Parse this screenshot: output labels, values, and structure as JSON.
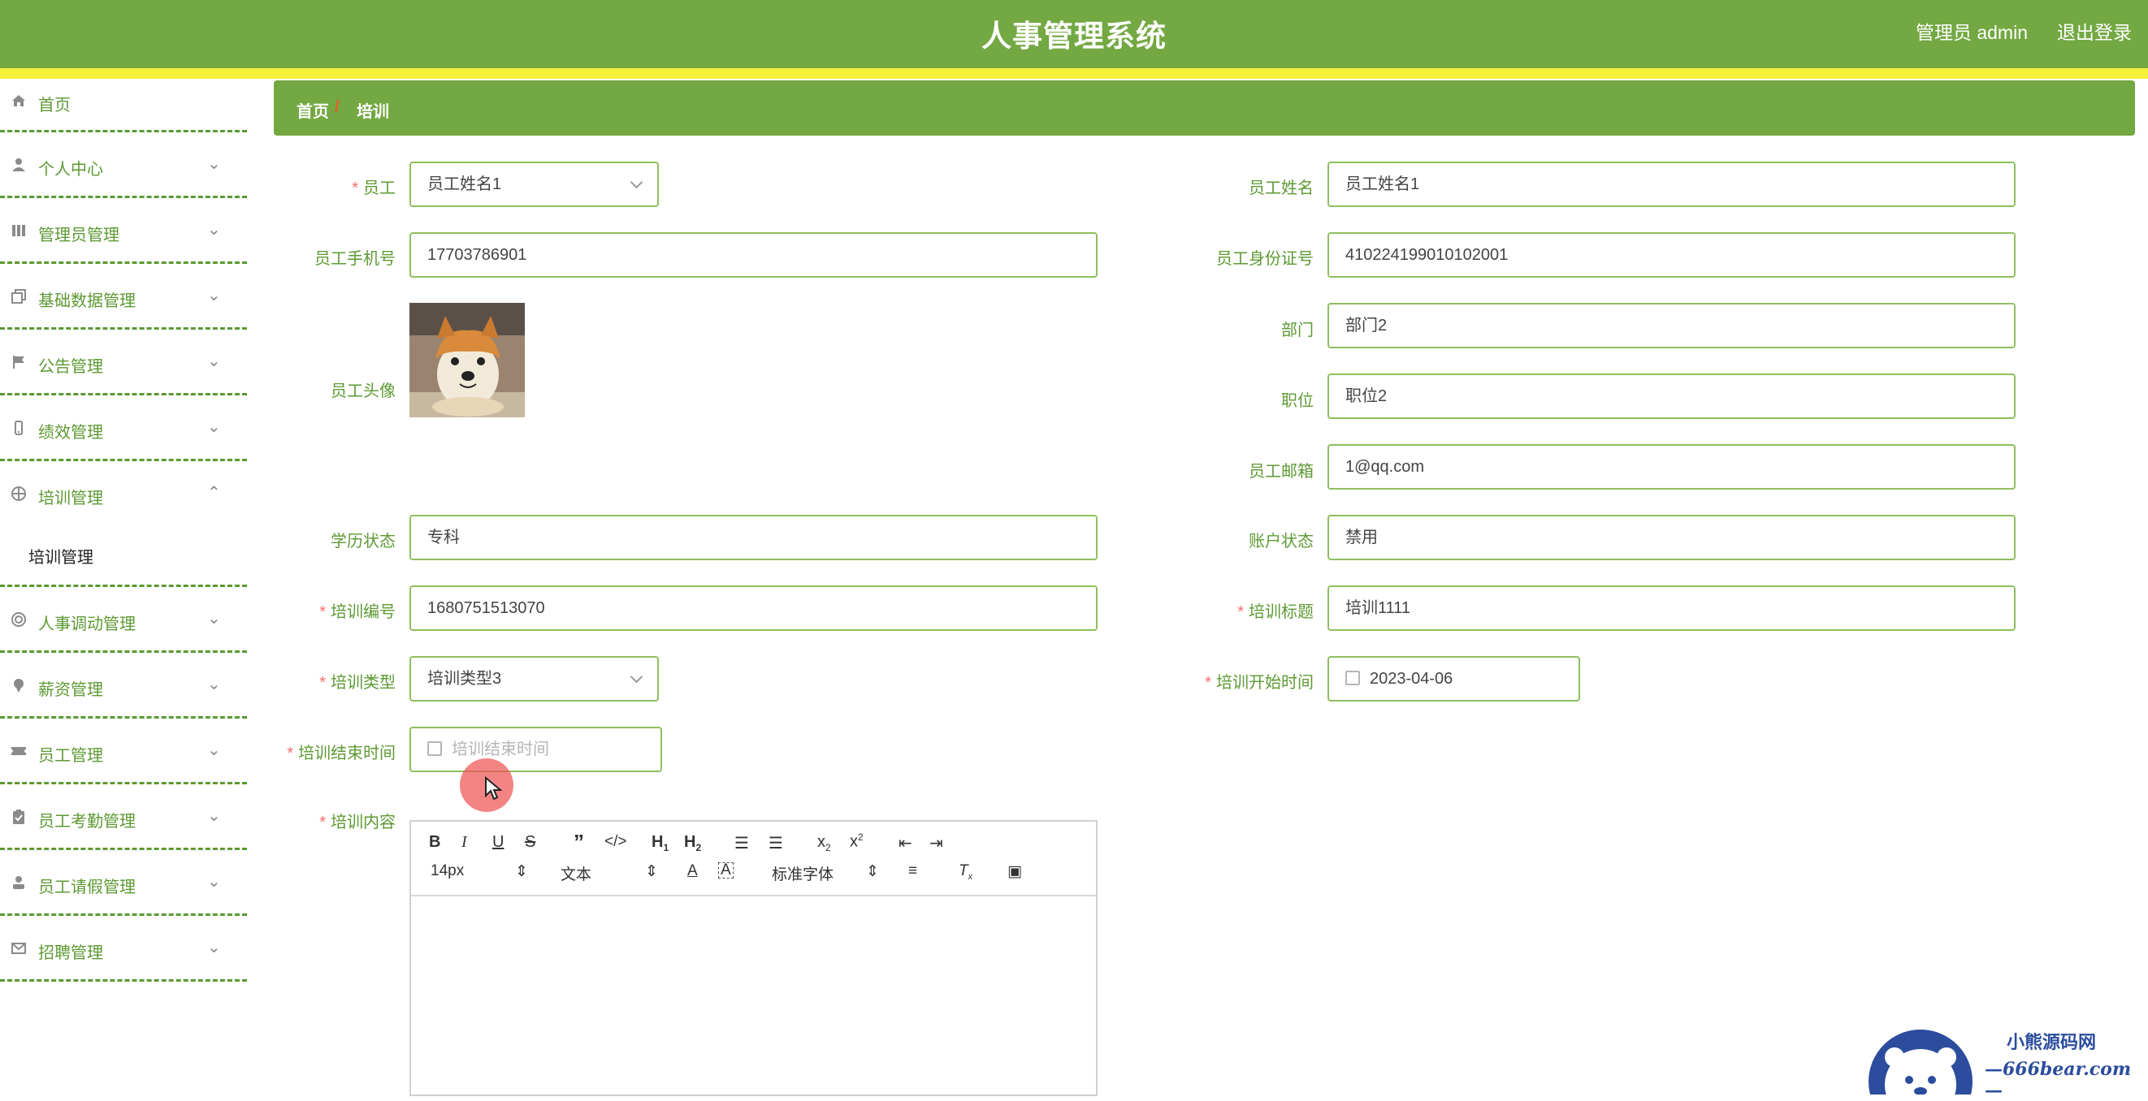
{
  "header": {
    "title": "人事管理系统",
    "user": "管理员 admin",
    "logout": "退出登录"
  },
  "sidebar": {
    "items": [
      {
        "label": "首页",
        "icon": "home-icon"
      },
      {
        "label": "个人中心",
        "icon": "user-icon"
      },
      {
        "label": "管理员管理",
        "icon": "columns-icon"
      },
      {
        "label": "基础数据管理",
        "icon": "copy-icon"
      },
      {
        "label": "公告管理",
        "icon": "flag-icon"
      },
      {
        "label": "绩效管理",
        "icon": "phone-icon"
      },
      {
        "label": "培训管理",
        "icon": "target-icon",
        "sub": "培训管理"
      },
      {
        "label": "人事调动管理",
        "icon": "lifebuoy-icon"
      },
      {
        "label": "薪资管理",
        "icon": "pin-icon"
      },
      {
        "label": "员工管理",
        "icon": "ticket-icon"
      },
      {
        "label": "员工考勤管理",
        "icon": "clipboard-icon"
      },
      {
        "label": "员工请假管理",
        "icon": "person-icon"
      },
      {
        "label": "招聘管理",
        "icon": "mail-icon"
      }
    ]
  },
  "breadcrumb": {
    "home": "首页",
    "separator": "/",
    "current": "培训"
  },
  "form": {
    "employee": {
      "label": "员工",
      "value": "员工姓名1"
    },
    "employee_name": {
      "label": "员工姓名",
      "value": "员工姓名1"
    },
    "phone": {
      "label": "员工手机号",
      "value": "17703786901"
    },
    "id_card": {
      "label": "员工身份证号",
      "value": "410224199010102001"
    },
    "avatar": {
      "label": "员工头像"
    },
    "department": {
      "label": "部门",
      "value": "部门2"
    },
    "position": {
      "label": "职位",
      "value": "职位2"
    },
    "email": {
      "label": "员工邮箱",
      "value": "1@qq.com"
    },
    "education": {
      "label": "学历状态",
      "value": "专科"
    },
    "account_status": {
      "label": "账户状态",
      "value": "禁用"
    },
    "training_no": {
      "label": "培训编号",
      "value": "1680751513070"
    },
    "training_title": {
      "label": "培训标题",
      "value": "培训1111"
    },
    "training_type": {
      "label": "培训类型",
      "value": "培训类型3"
    },
    "start_time": {
      "label": "培训开始时间",
      "value": "2023-04-06"
    },
    "end_time": {
      "label": "培训结束时间",
      "placeholder": "培训结束时间"
    },
    "content": {
      "label": "培训内容"
    }
  },
  "editor": {
    "font_size": "14px",
    "block_type": "文本",
    "font_family": "标准字体",
    "buttons": [
      "bold-icon",
      "italic-icon",
      "underline-icon",
      "strike-icon",
      "quote-icon",
      "code-icon",
      "h1-icon",
      "h2-icon",
      "ordered-list-icon",
      "bullet-list-icon",
      "subscript-icon",
      "superscript-icon",
      "outdent-icon",
      "indent-icon",
      "font-color-icon",
      "background-color-icon",
      "align-icon",
      "clear-format-icon",
      "image-icon"
    ]
  },
  "watermark": {
    "title": "小熊源码网",
    "url": "—666bear.com—"
  },
  "colors": {
    "primary": "#73a842",
    "accent_strip": "#f5f03a",
    "label": "#5d9a33",
    "required": "#f56c6c"
  }
}
